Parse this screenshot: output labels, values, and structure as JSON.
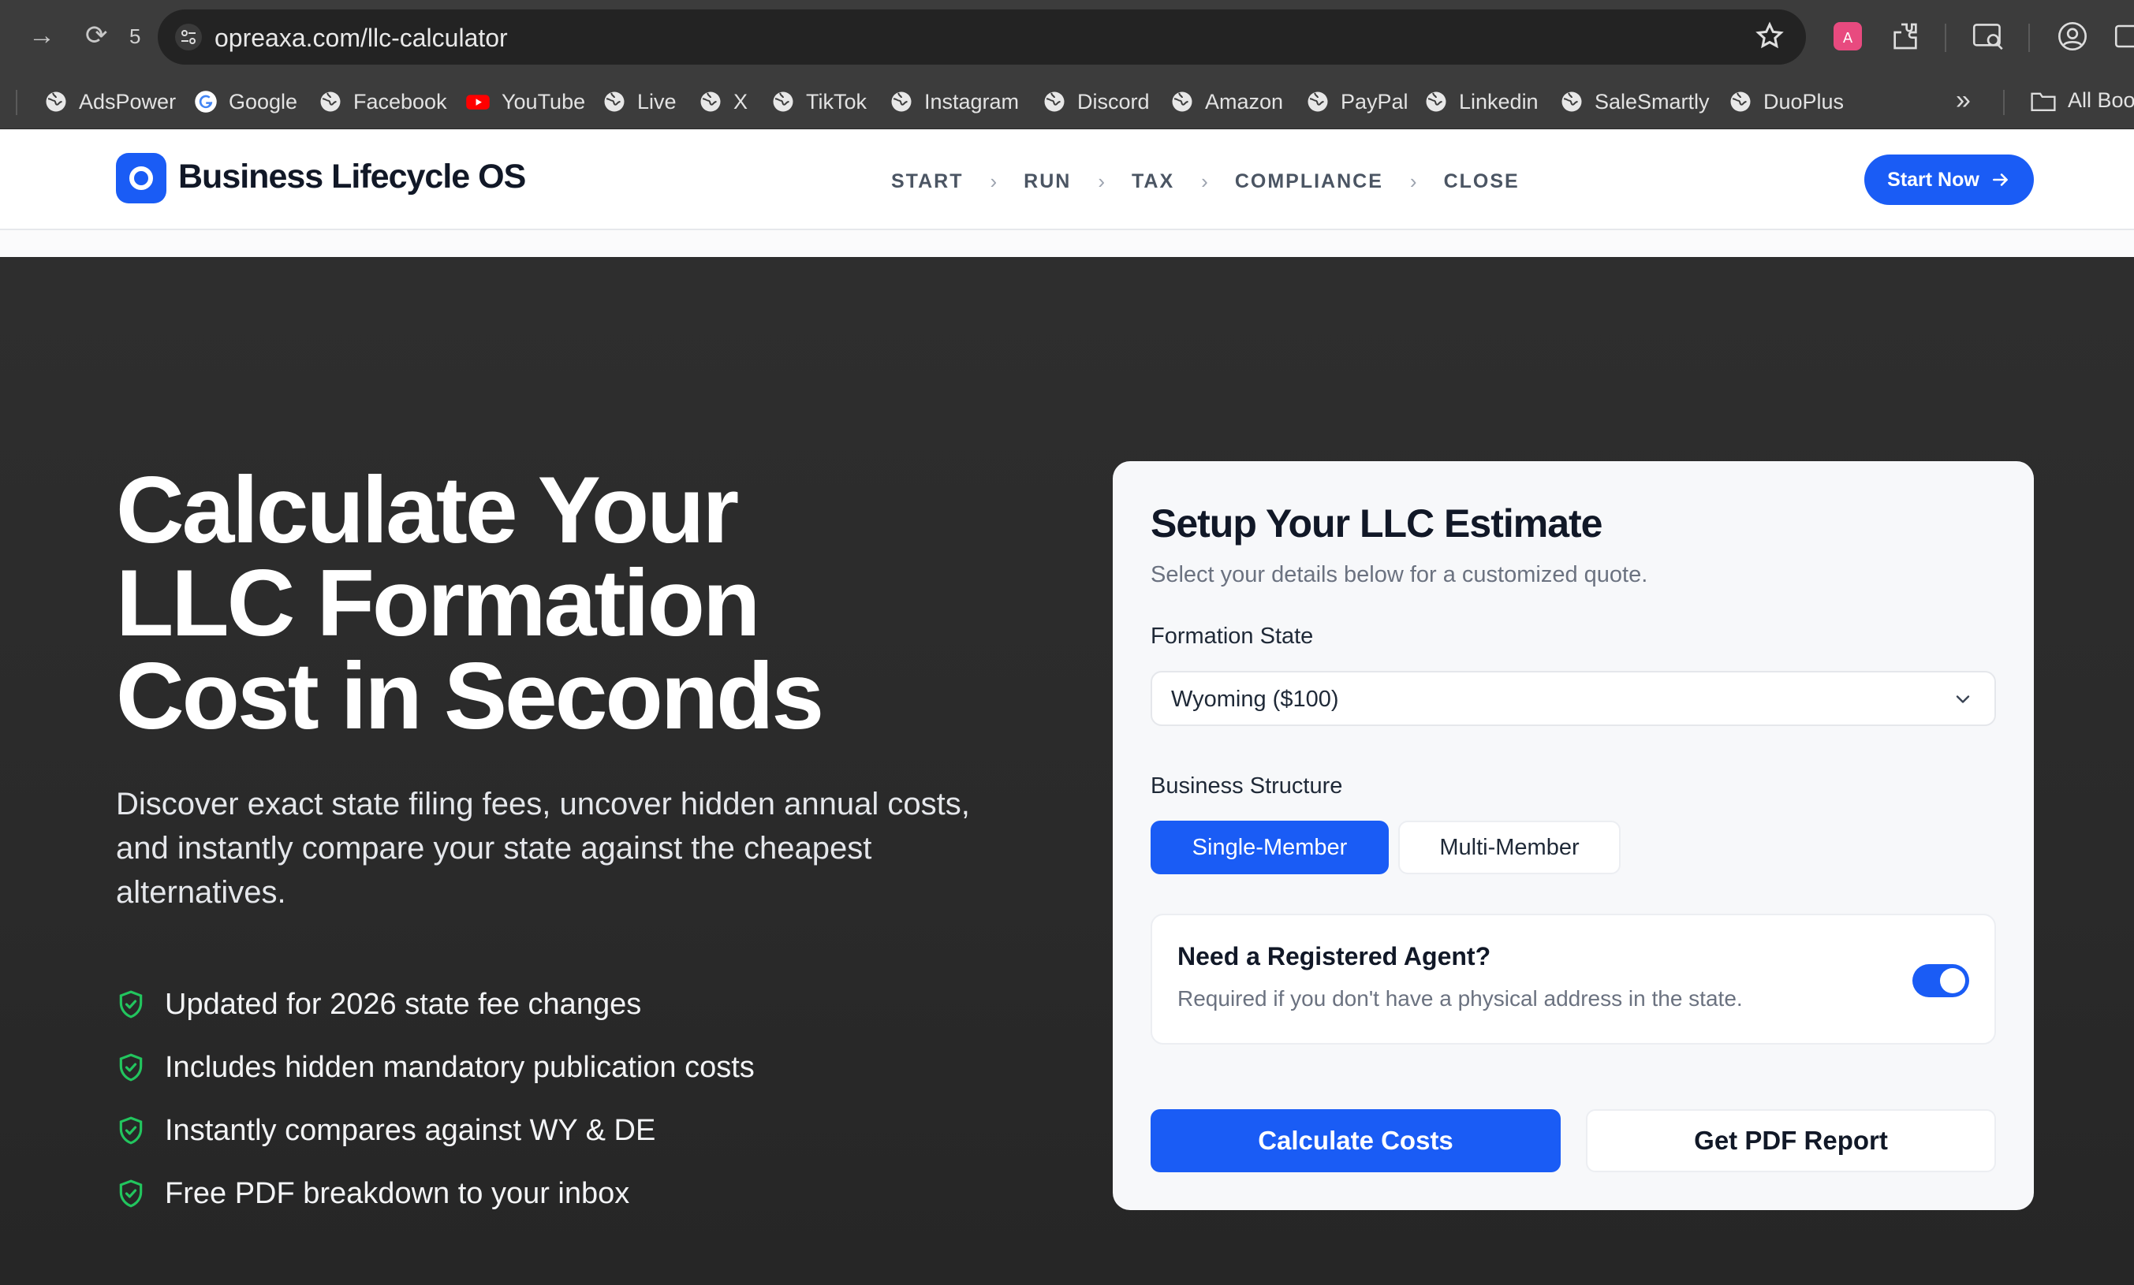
{
  "browser": {
    "url": "opreaxa.com/llc-calculator",
    "tab_count": "5",
    "bookmarks": [
      {
        "label": "AdsPower",
        "icon": "globe-icon"
      },
      {
        "label": "Google",
        "icon": "google-icon"
      },
      {
        "label": "Facebook",
        "icon": "globe-icon"
      },
      {
        "label": "YouTube",
        "icon": "youtube-icon"
      },
      {
        "label": "Live",
        "icon": "globe-icon"
      },
      {
        "label": "X",
        "icon": "globe-icon"
      },
      {
        "label": "TikTok",
        "icon": "globe-icon"
      },
      {
        "label": "Instagram",
        "icon": "globe-icon"
      },
      {
        "label": "Discord",
        "icon": "globe-icon"
      },
      {
        "label": "Amazon",
        "icon": "globe-icon"
      },
      {
        "label": "PayPal",
        "icon": "globe-icon"
      },
      {
        "label": "Linkedin",
        "icon": "globe-icon"
      },
      {
        "label": "SaleSmartly",
        "icon": "globe-icon"
      },
      {
        "label": "DuoPlus",
        "icon": "globe-icon"
      }
    ],
    "more_bookmarks": "»",
    "all_bookmarks": "All Boo"
  },
  "header": {
    "brand": "Business Lifecycle OS",
    "steps": [
      "START",
      "RUN",
      "TAX",
      "COMPLIANCE",
      "CLOSE"
    ],
    "cta": "Start Now"
  },
  "hero": {
    "title_lines": [
      "Calculate Your",
      "LLC Formation",
      "Cost in Seconds"
    ],
    "subtitle": "Discover exact state filing fees, uncover hidden annual costs, and instantly compare your state against the cheapest alternatives.",
    "features": [
      "Updated for 2026 state fee changes",
      "Includes hidden mandatory publication costs",
      "Instantly compares against WY & DE",
      "Free PDF breakdown to your inbox"
    ]
  },
  "card": {
    "title": "Setup Your LLC Estimate",
    "subtitle": "Select your details below for a customized quote.",
    "state_label": "Formation State",
    "state_value": "Wyoming ($100)",
    "structure_label": "Business Structure",
    "structure_options": [
      "Single-Member",
      "Multi-Member"
    ],
    "structure_selected": "Single-Member",
    "agent_title": "Need a Registered Agent?",
    "agent_sub": "Required if you don't have a physical address in the state.",
    "agent_enabled": true,
    "calc_button": "Calculate Costs",
    "pdf_button": "Get PDF Report"
  },
  "colors": {
    "accent": "#1a5cf5",
    "check": "#22c55e"
  }
}
